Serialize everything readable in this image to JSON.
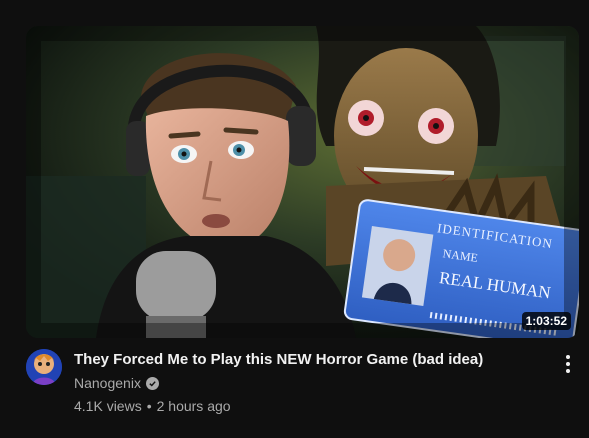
{
  "video": {
    "title": "They Forced Me to Play this NEW Horror Game (bad idea)",
    "duration": "1:03:52",
    "channel": "Nanogenix",
    "views": "4.1K views",
    "age": "2 hours ago",
    "separator": "•"
  },
  "thumbnail": {
    "card_heading": "IDENTIFICATION",
    "name_label": "NAME",
    "name_value": "REAL HUMAN"
  },
  "icons": {
    "verified": "verified-check-icon",
    "menu": "more-vert-icon"
  },
  "colors": {
    "background": "#0f0f0f",
    "title_text": "#f1f1f1",
    "secondary_text": "#aaaaaa",
    "id_card": "#3a6fd8"
  }
}
